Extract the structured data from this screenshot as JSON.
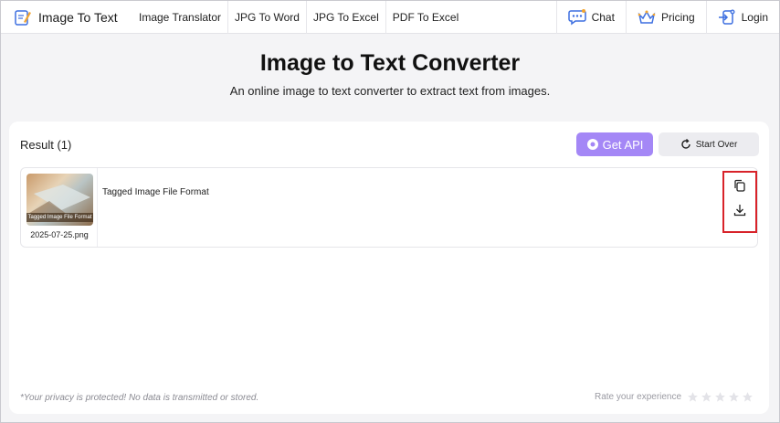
{
  "brand": {
    "name": "Image To Text",
    "icon": "edit-document-icon"
  },
  "nav": {
    "links": [
      "Image Translator",
      "JPG To Word",
      "JPG To Excel",
      "PDF To Excel"
    ],
    "chat": "Chat",
    "pricing": "Pricing",
    "login": "Login"
  },
  "hero": {
    "title": "Image to Text Converter",
    "subtitle": "An online image to text converter to extract text from images."
  },
  "result": {
    "title": "Result (1)",
    "get_api": "Get API",
    "start_over": "Start Over",
    "items": [
      {
        "filename": "2025-07-25.png",
        "thumb_caption": "Tagged Image File Format",
        "text": "Tagged Image File Format"
      }
    ]
  },
  "footer": {
    "privacy": "*Your privacy is protected! No data is transmitted or stored.",
    "rate_label": "Rate your experience",
    "stars": 5
  },
  "colors": {
    "accent": "#a487f6",
    "highlight": "#d8232a",
    "background": "#f4f4f6"
  }
}
